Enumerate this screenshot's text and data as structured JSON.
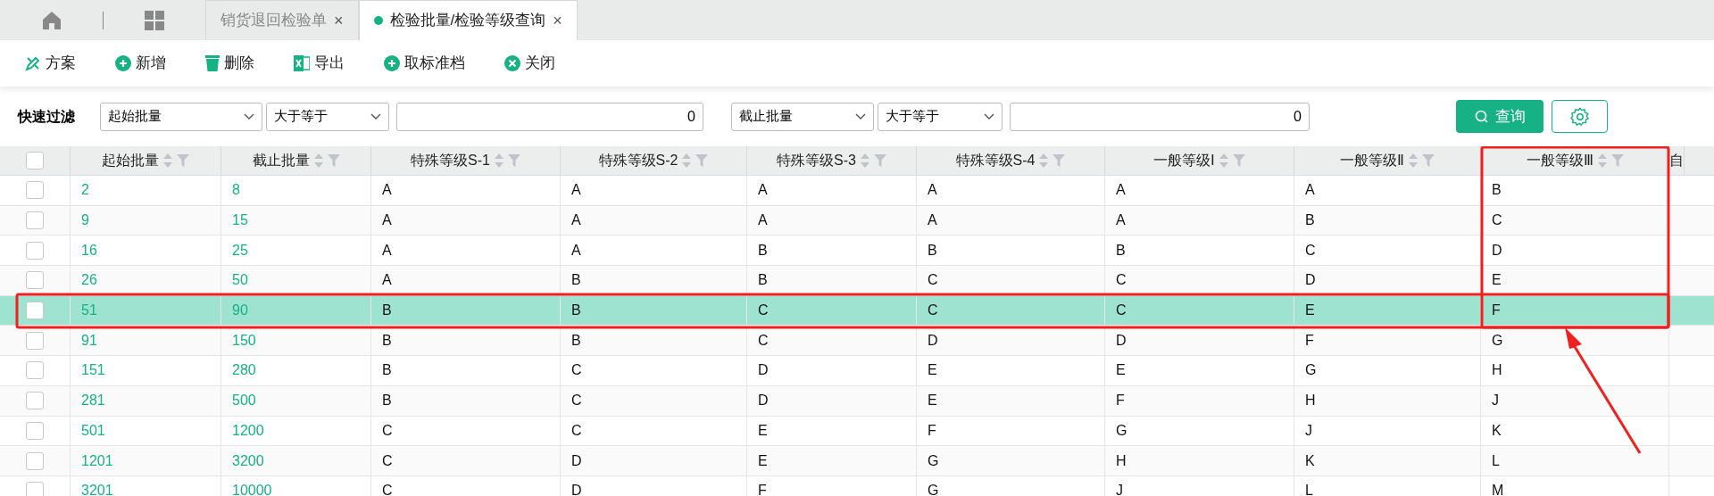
{
  "tabs": [
    {
      "label": "销货退回检验单",
      "selected": false,
      "close": "×"
    },
    {
      "label": "检验批量/检验等级查询",
      "selected": true,
      "close": "×"
    }
  ],
  "toolbar": [
    {
      "kind": "scheme",
      "label": "方案"
    },
    {
      "kind": "add",
      "label": "新增"
    },
    {
      "kind": "delete",
      "label": "删除"
    },
    {
      "kind": "export",
      "label": "导出"
    },
    {
      "kind": "add",
      "label": "取标准档"
    },
    {
      "kind": "close",
      "label": "关闭"
    }
  ],
  "filter": {
    "label": "快速过滤",
    "conditions": [
      {
        "field": "起始批量",
        "operator": "大于等于",
        "value": "0"
      },
      {
        "field": "截止批量",
        "operator": "大于等于",
        "value": "0"
      }
    ],
    "search_button": "查询"
  },
  "table": {
    "all_checked": false,
    "columns": [
      "起始批量",
      "截止批量",
      "特殊等级S-1",
      "特殊等级S-2",
      "特殊等级S-3",
      "特殊等级S-4",
      "一般等级Ⅰ",
      "一般等级Ⅱ",
      "一般等级Ⅲ",
      "自"
    ],
    "rows": [
      {
        "selected": false,
        "checked": false,
        "cells": [
          "2",
          "8",
          "A",
          "A",
          "A",
          "A",
          "A",
          "A",
          "B"
        ]
      },
      {
        "selected": false,
        "checked": false,
        "cells": [
          "9",
          "15",
          "A",
          "A",
          "A",
          "A",
          "A",
          "B",
          "C"
        ]
      },
      {
        "selected": false,
        "checked": false,
        "cells": [
          "16",
          "25",
          "A",
          "A",
          "B",
          "B",
          "B",
          "C",
          "D"
        ]
      },
      {
        "selected": false,
        "checked": false,
        "cells": [
          "26",
          "50",
          "A",
          "B",
          "B",
          "C",
          "C",
          "D",
          "E"
        ]
      },
      {
        "selected": true,
        "checked": false,
        "cells": [
          "51",
          "90",
          "B",
          "B",
          "C",
          "C",
          "C",
          "E",
          "F"
        ]
      },
      {
        "selected": false,
        "checked": false,
        "cells": [
          "91",
          "150",
          "B",
          "B",
          "C",
          "D",
          "D",
          "F",
          "G"
        ]
      },
      {
        "selected": false,
        "checked": false,
        "cells": [
          "151",
          "280",
          "B",
          "C",
          "D",
          "E",
          "E",
          "G",
          "H"
        ]
      },
      {
        "selected": false,
        "checked": false,
        "cells": [
          "281",
          "500",
          "B",
          "C",
          "D",
          "E",
          "F",
          "H",
          "J"
        ]
      },
      {
        "selected": false,
        "checked": false,
        "cells": [
          "501",
          "1200",
          "C",
          "C",
          "E",
          "F",
          "G",
          "J",
          "K"
        ]
      },
      {
        "selected": false,
        "checked": false,
        "cells": [
          "1201",
          "3200",
          "C",
          "D",
          "E",
          "G",
          "H",
          "K",
          "L"
        ]
      },
      {
        "selected": false,
        "checked": false,
        "cells": [
          "3201",
          "10000",
          "C",
          "D",
          "F",
          "G",
          "J",
          "L",
          "M"
        ]
      }
    ]
  }
}
